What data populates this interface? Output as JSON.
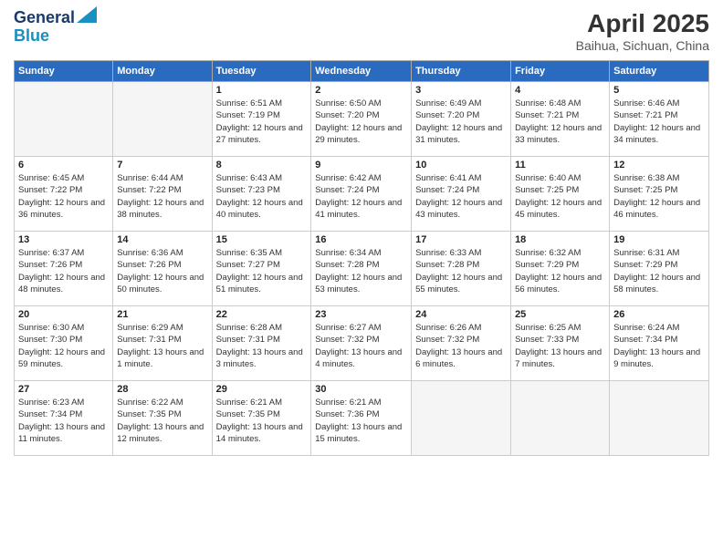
{
  "header": {
    "logo_line1": "General",
    "logo_line2": "Blue",
    "main_title": "April 2025",
    "subtitle": "Baihua, Sichuan, China"
  },
  "days_of_week": [
    "Sunday",
    "Monday",
    "Tuesday",
    "Wednesday",
    "Thursday",
    "Friday",
    "Saturday"
  ],
  "weeks": [
    [
      {
        "day": "",
        "sunrise": "",
        "sunset": "",
        "daylight": "",
        "empty": true
      },
      {
        "day": "",
        "sunrise": "",
        "sunset": "",
        "daylight": "",
        "empty": true
      },
      {
        "day": "1",
        "sunrise": "Sunrise: 6:51 AM",
        "sunset": "Sunset: 7:19 PM",
        "daylight": "Daylight: 12 hours and 27 minutes.",
        "empty": false
      },
      {
        "day": "2",
        "sunrise": "Sunrise: 6:50 AM",
        "sunset": "Sunset: 7:20 PM",
        "daylight": "Daylight: 12 hours and 29 minutes.",
        "empty": false
      },
      {
        "day": "3",
        "sunrise": "Sunrise: 6:49 AM",
        "sunset": "Sunset: 7:20 PM",
        "daylight": "Daylight: 12 hours and 31 minutes.",
        "empty": false
      },
      {
        "day": "4",
        "sunrise": "Sunrise: 6:48 AM",
        "sunset": "Sunset: 7:21 PM",
        "daylight": "Daylight: 12 hours and 33 minutes.",
        "empty": false
      },
      {
        "day": "5",
        "sunrise": "Sunrise: 6:46 AM",
        "sunset": "Sunset: 7:21 PM",
        "daylight": "Daylight: 12 hours and 34 minutes.",
        "empty": false
      }
    ],
    [
      {
        "day": "6",
        "sunrise": "Sunrise: 6:45 AM",
        "sunset": "Sunset: 7:22 PM",
        "daylight": "Daylight: 12 hours and 36 minutes.",
        "empty": false
      },
      {
        "day": "7",
        "sunrise": "Sunrise: 6:44 AM",
        "sunset": "Sunset: 7:22 PM",
        "daylight": "Daylight: 12 hours and 38 minutes.",
        "empty": false
      },
      {
        "day": "8",
        "sunrise": "Sunrise: 6:43 AM",
        "sunset": "Sunset: 7:23 PM",
        "daylight": "Daylight: 12 hours and 40 minutes.",
        "empty": false
      },
      {
        "day": "9",
        "sunrise": "Sunrise: 6:42 AM",
        "sunset": "Sunset: 7:24 PM",
        "daylight": "Daylight: 12 hours and 41 minutes.",
        "empty": false
      },
      {
        "day": "10",
        "sunrise": "Sunrise: 6:41 AM",
        "sunset": "Sunset: 7:24 PM",
        "daylight": "Daylight: 12 hours and 43 minutes.",
        "empty": false
      },
      {
        "day": "11",
        "sunrise": "Sunrise: 6:40 AM",
        "sunset": "Sunset: 7:25 PM",
        "daylight": "Daylight: 12 hours and 45 minutes.",
        "empty": false
      },
      {
        "day": "12",
        "sunrise": "Sunrise: 6:38 AM",
        "sunset": "Sunset: 7:25 PM",
        "daylight": "Daylight: 12 hours and 46 minutes.",
        "empty": false
      }
    ],
    [
      {
        "day": "13",
        "sunrise": "Sunrise: 6:37 AM",
        "sunset": "Sunset: 7:26 PM",
        "daylight": "Daylight: 12 hours and 48 minutes.",
        "empty": false
      },
      {
        "day": "14",
        "sunrise": "Sunrise: 6:36 AM",
        "sunset": "Sunset: 7:26 PM",
        "daylight": "Daylight: 12 hours and 50 minutes.",
        "empty": false
      },
      {
        "day": "15",
        "sunrise": "Sunrise: 6:35 AM",
        "sunset": "Sunset: 7:27 PM",
        "daylight": "Daylight: 12 hours and 51 minutes.",
        "empty": false
      },
      {
        "day": "16",
        "sunrise": "Sunrise: 6:34 AM",
        "sunset": "Sunset: 7:28 PM",
        "daylight": "Daylight: 12 hours and 53 minutes.",
        "empty": false
      },
      {
        "day": "17",
        "sunrise": "Sunrise: 6:33 AM",
        "sunset": "Sunset: 7:28 PM",
        "daylight": "Daylight: 12 hours and 55 minutes.",
        "empty": false
      },
      {
        "day": "18",
        "sunrise": "Sunrise: 6:32 AM",
        "sunset": "Sunset: 7:29 PM",
        "daylight": "Daylight: 12 hours and 56 minutes.",
        "empty": false
      },
      {
        "day": "19",
        "sunrise": "Sunrise: 6:31 AM",
        "sunset": "Sunset: 7:29 PM",
        "daylight": "Daylight: 12 hours and 58 minutes.",
        "empty": false
      }
    ],
    [
      {
        "day": "20",
        "sunrise": "Sunrise: 6:30 AM",
        "sunset": "Sunset: 7:30 PM",
        "daylight": "Daylight: 12 hours and 59 minutes.",
        "empty": false
      },
      {
        "day": "21",
        "sunrise": "Sunrise: 6:29 AM",
        "sunset": "Sunset: 7:31 PM",
        "daylight": "Daylight: 13 hours and 1 minute.",
        "empty": false
      },
      {
        "day": "22",
        "sunrise": "Sunrise: 6:28 AM",
        "sunset": "Sunset: 7:31 PM",
        "daylight": "Daylight: 13 hours and 3 minutes.",
        "empty": false
      },
      {
        "day": "23",
        "sunrise": "Sunrise: 6:27 AM",
        "sunset": "Sunset: 7:32 PM",
        "daylight": "Daylight: 13 hours and 4 minutes.",
        "empty": false
      },
      {
        "day": "24",
        "sunrise": "Sunrise: 6:26 AM",
        "sunset": "Sunset: 7:32 PM",
        "daylight": "Daylight: 13 hours and 6 minutes.",
        "empty": false
      },
      {
        "day": "25",
        "sunrise": "Sunrise: 6:25 AM",
        "sunset": "Sunset: 7:33 PM",
        "daylight": "Daylight: 13 hours and 7 minutes.",
        "empty": false
      },
      {
        "day": "26",
        "sunrise": "Sunrise: 6:24 AM",
        "sunset": "Sunset: 7:34 PM",
        "daylight": "Daylight: 13 hours and 9 minutes.",
        "empty": false
      }
    ],
    [
      {
        "day": "27",
        "sunrise": "Sunrise: 6:23 AM",
        "sunset": "Sunset: 7:34 PM",
        "daylight": "Daylight: 13 hours and 11 minutes.",
        "empty": false
      },
      {
        "day": "28",
        "sunrise": "Sunrise: 6:22 AM",
        "sunset": "Sunset: 7:35 PM",
        "daylight": "Daylight: 13 hours and 12 minutes.",
        "empty": false
      },
      {
        "day": "29",
        "sunrise": "Sunrise: 6:21 AM",
        "sunset": "Sunset: 7:35 PM",
        "daylight": "Daylight: 13 hours and 14 minutes.",
        "empty": false
      },
      {
        "day": "30",
        "sunrise": "Sunrise: 6:21 AM",
        "sunset": "Sunset: 7:36 PM",
        "daylight": "Daylight: 13 hours and 15 minutes.",
        "empty": false
      },
      {
        "day": "",
        "sunrise": "",
        "sunset": "",
        "daylight": "",
        "empty": true
      },
      {
        "day": "",
        "sunrise": "",
        "sunset": "",
        "daylight": "",
        "empty": true
      },
      {
        "day": "",
        "sunrise": "",
        "sunset": "",
        "daylight": "",
        "empty": true
      }
    ]
  ]
}
